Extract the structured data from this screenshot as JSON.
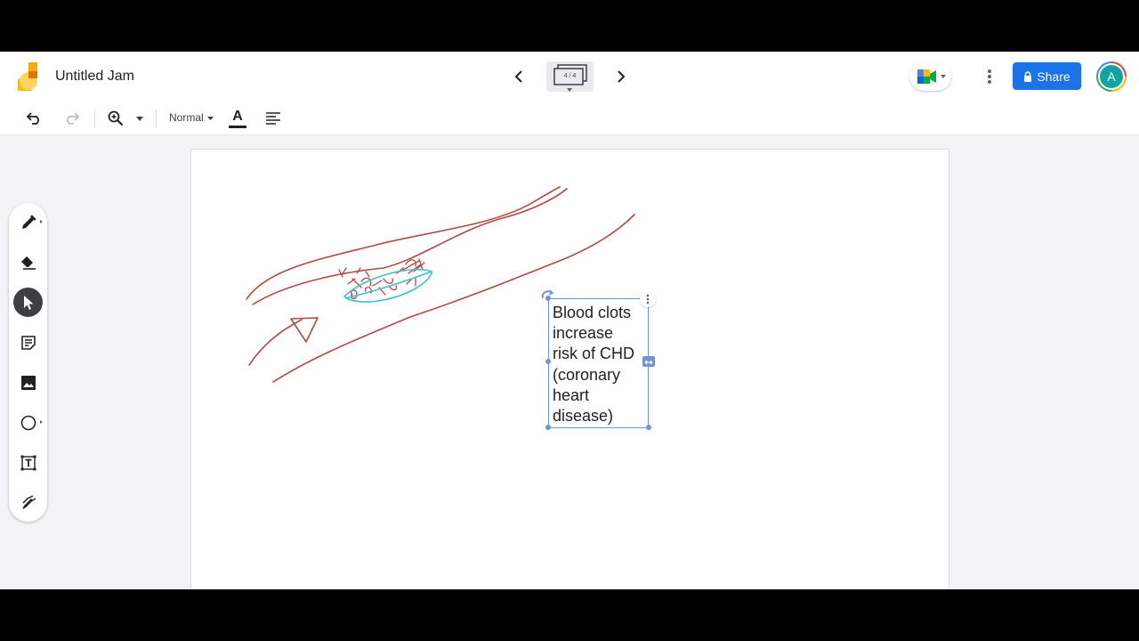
{
  "app": {
    "title": "Untitled Jam",
    "frame_indicator": "4 / 4",
    "share_label": "Share",
    "avatar_initial": "A"
  },
  "toolbar": {
    "font_size": "Normal",
    "text_color_glyph": "A",
    "icons": [
      "undo-icon",
      "redo-icon",
      "zoom-icon",
      "zoom-dropdown-icon",
      "text-color-icon",
      "align-icon"
    ]
  },
  "tools": [
    "pen-icon",
    "eraser-icon",
    "select-icon",
    "sticky-note-icon",
    "image-icon",
    "circle-shape-icon",
    "text-box-icon",
    "laser-icon"
  ],
  "active_tool": "select",
  "textbox": {
    "lines": [
      "Blood clots",
      "increase",
      "risk of CHD",
      "(coronary",
      "heart",
      "disease)"
    ]
  },
  "colors": {
    "share": "#1a73e8",
    "ink_red": "#b5483f",
    "ink_cyan": "#3ebfcf",
    "selection": "#6f95d6",
    "avatar": "#12a4a0"
  }
}
